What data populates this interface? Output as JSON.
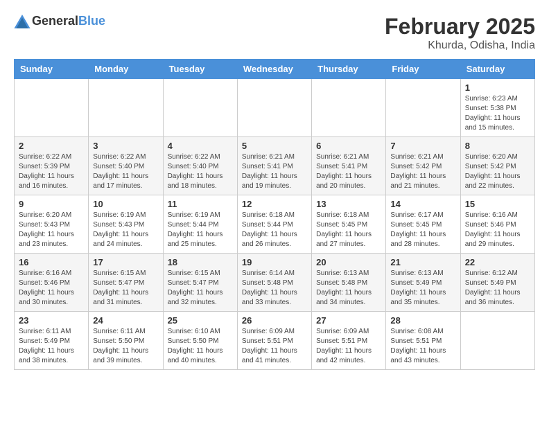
{
  "header": {
    "logo": {
      "text_general": "General",
      "text_blue": "Blue"
    },
    "title": "February 2025",
    "subtitle": "Khurda, Odisha, India"
  },
  "calendar": {
    "days_of_week": [
      "Sunday",
      "Monday",
      "Tuesday",
      "Wednesday",
      "Thursday",
      "Friday",
      "Saturday"
    ],
    "weeks": [
      [
        {
          "day": "",
          "info": ""
        },
        {
          "day": "",
          "info": ""
        },
        {
          "day": "",
          "info": ""
        },
        {
          "day": "",
          "info": ""
        },
        {
          "day": "",
          "info": ""
        },
        {
          "day": "",
          "info": ""
        },
        {
          "day": "1",
          "info": "Sunrise: 6:23 AM\nSunset: 5:38 PM\nDaylight: 11 hours and 15 minutes."
        }
      ],
      [
        {
          "day": "2",
          "info": "Sunrise: 6:22 AM\nSunset: 5:39 PM\nDaylight: 11 hours and 16 minutes."
        },
        {
          "day": "3",
          "info": "Sunrise: 6:22 AM\nSunset: 5:40 PM\nDaylight: 11 hours and 17 minutes."
        },
        {
          "day": "4",
          "info": "Sunrise: 6:22 AM\nSunset: 5:40 PM\nDaylight: 11 hours and 18 minutes."
        },
        {
          "day": "5",
          "info": "Sunrise: 6:21 AM\nSunset: 5:41 PM\nDaylight: 11 hours and 19 minutes."
        },
        {
          "day": "6",
          "info": "Sunrise: 6:21 AM\nSunset: 5:41 PM\nDaylight: 11 hours and 20 minutes."
        },
        {
          "day": "7",
          "info": "Sunrise: 6:21 AM\nSunset: 5:42 PM\nDaylight: 11 hours and 21 minutes."
        },
        {
          "day": "8",
          "info": "Sunrise: 6:20 AM\nSunset: 5:42 PM\nDaylight: 11 hours and 22 minutes."
        }
      ],
      [
        {
          "day": "9",
          "info": "Sunrise: 6:20 AM\nSunset: 5:43 PM\nDaylight: 11 hours and 23 minutes."
        },
        {
          "day": "10",
          "info": "Sunrise: 6:19 AM\nSunset: 5:43 PM\nDaylight: 11 hours and 24 minutes."
        },
        {
          "day": "11",
          "info": "Sunrise: 6:19 AM\nSunset: 5:44 PM\nDaylight: 11 hours and 25 minutes."
        },
        {
          "day": "12",
          "info": "Sunrise: 6:18 AM\nSunset: 5:44 PM\nDaylight: 11 hours and 26 minutes."
        },
        {
          "day": "13",
          "info": "Sunrise: 6:18 AM\nSunset: 5:45 PM\nDaylight: 11 hours and 27 minutes."
        },
        {
          "day": "14",
          "info": "Sunrise: 6:17 AM\nSunset: 5:45 PM\nDaylight: 11 hours and 28 minutes."
        },
        {
          "day": "15",
          "info": "Sunrise: 6:16 AM\nSunset: 5:46 PM\nDaylight: 11 hours and 29 minutes."
        }
      ],
      [
        {
          "day": "16",
          "info": "Sunrise: 6:16 AM\nSunset: 5:46 PM\nDaylight: 11 hours and 30 minutes."
        },
        {
          "day": "17",
          "info": "Sunrise: 6:15 AM\nSunset: 5:47 PM\nDaylight: 11 hours and 31 minutes."
        },
        {
          "day": "18",
          "info": "Sunrise: 6:15 AM\nSunset: 5:47 PM\nDaylight: 11 hours and 32 minutes."
        },
        {
          "day": "19",
          "info": "Sunrise: 6:14 AM\nSunset: 5:48 PM\nDaylight: 11 hours and 33 minutes."
        },
        {
          "day": "20",
          "info": "Sunrise: 6:13 AM\nSunset: 5:48 PM\nDaylight: 11 hours and 34 minutes."
        },
        {
          "day": "21",
          "info": "Sunrise: 6:13 AM\nSunset: 5:49 PM\nDaylight: 11 hours and 35 minutes."
        },
        {
          "day": "22",
          "info": "Sunrise: 6:12 AM\nSunset: 5:49 PM\nDaylight: 11 hours and 36 minutes."
        }
      ],
      [
        {
          "day": "23",
          "info": "Sunrise: 6:11 AM\nSunset: 5:49 PM\nDaylight: 11 hours and 38 minutes."
        },
        {
          "day": "24",
          "info": "Sunrise: 6:11 AM\nSunset: 5:50 PM\nDaylight: 11 hours and 39 minutes."
        },
        {
          "day": "25",
          "info": "Sunrise: 6:10 AM\nSunset: 5:50 PM\nDaylight: 11 hours and 40 minutes."
        },
        {
          "day": "26",
          "info": "Sunrise: 6:09 AM\nSunset: 5:51 PM\nDaylight: 11 hours and 41 minutes."
        },
        {
          "day": "27",
          "info": "Sunrise: 6:09 AM\nSunset: 5:51 PM\nDaylight: 11 hours and 42 minutes."
        },
        {
          "day": "28",
          "info": "Sunrise: 6:08 AM\nSunset: 5:51 PM\nDaylight: 11 hours and 43 minutes."
        },
        {
          "day": "",
          "info": ""
        }
      ]
    ]
  }
}
